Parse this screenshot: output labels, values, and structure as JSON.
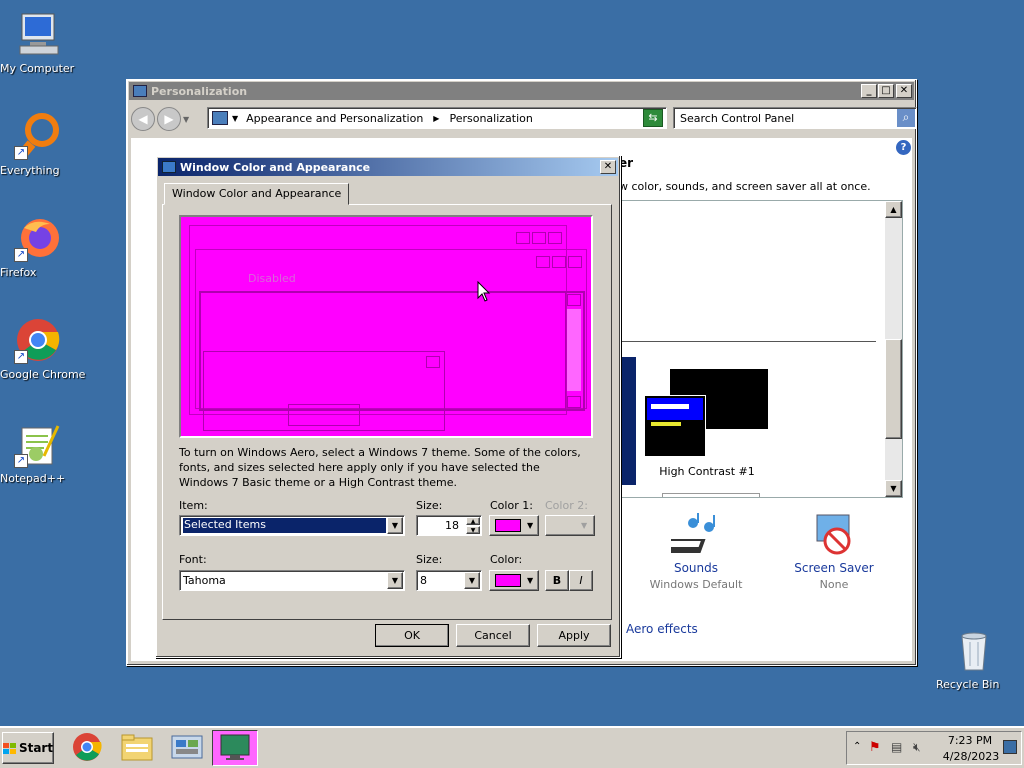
{
  "desktop": {
    "icons": [
      {
        "label": "My Computer",
        "icon": "computer-icon"
      },
      {
        "label": "Everything",
        "icon": "everything-icon"
      },
      {
        "label": "Firefox",
        "icon": "firefox-icon"
      },
      {
        "label": "Google Chrome",
        "icon": "chrome-icon"
      },
      {
        "label": "Notepad++",
        "icon": "notepad-plus-plus-icon"
      },
      {
        "label": "Recycle Bin",
        "icon": "recycle-bin-icon"
      }
    ]
  },
  "personalization": {
    "title": "Personalization",
    "breadcrumb": [
      "Appearance and Personalization",
      "Personalization"
    ],
    "search_placeholder": "Search Control Panel",
    "heading_partial": "er",
    "subtitle_partial": "w color, sounds, and screen saver all at once.",
    "theme_name": "High Contrast #1",
    "sounds_label": "Sounds",
    "sounds_value": "Windows Default",
    "screensaver_label": "Screen Saver",
    "screensaver_value": "None",
    "aero_link": "Aero effects"
  },
  "dialog": {
    "title": "Window Color and Appearance",
    "tab_label": "Window Color and Appearance",
    "preview_disabled_text": "Disabled",
    "info_text": "To turn on Windows Aero, select a Windows 7 theme.  Some of the colors, fonts, and sizes selected here apply only if you have selected the Windows 7 Basic theme or a High Contrast theme.",
    "item_label": "Item:",
    "item_value": "Selected Items",
    "size_label": "Size:",
    "size_value": "18",
    "color1_label": "Color 1:",
    "color2_label": "Color 2:",
    "font_label": "Font:",
    "font_value": "Tahoma",
    "font_size_label": "Size:",
    "font_size_value": "8",
    "font_color_label": "Color:",
    "bold_label": "B",
    "italic_label": "I",
    "ok_label": "OK",
    "cancel_label": "Cancel",
    "apply_label": "Apply",
    "swatch_color": "#ff00ff"
  },
  "taskbar": {
    "start_label": "Start",
    "time": "7:23 PM",
    "date": "4/28/2023"
  }
}
